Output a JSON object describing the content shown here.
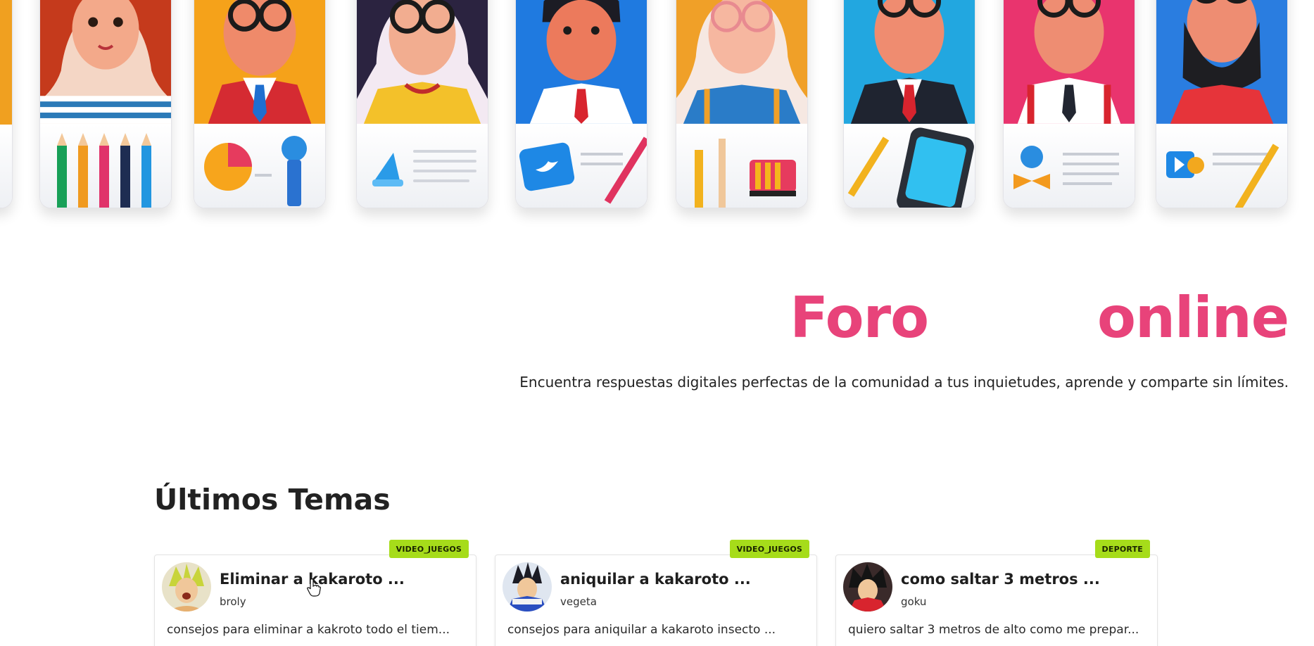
{
  "hero": {
    "title_left": "Foro",
    "title_right": "online",
    "subtitle": "Encuentra respuestas digitales perfectas de la comunidad a tus inquietudes, aprende y comparte sin límites."
  },
  "latest": {
    "heading": "Últimos Temas",
    "topics": [
      {
        "category": "VIDEO_JUEGOS",
        "title": "Eliminar a kakaroto ...",
        "author": "broly",
        "excerpt": "consejos para eliminar a kakroto todo el tiem..."
      },
      {
        "category": "VIDEO_JUEGOS",
        "title": "aniquilar a kakaroto ...",
        "author": "vegeta",
        "excerpt": "consejos para aniquilar a kakaroto insecto ..."
      },
      {
        "category": "DEPORTE",
        "title": "como saltar 3 metros ...",
        "author": "goku",
        "excerpt": "quiero saltar 3 metros de alto como me prepar..."
      }
    ]
  },
  "colors": {
    "accent": "#e8437a",
    "badge": "#a6dc1a"
  }
}
